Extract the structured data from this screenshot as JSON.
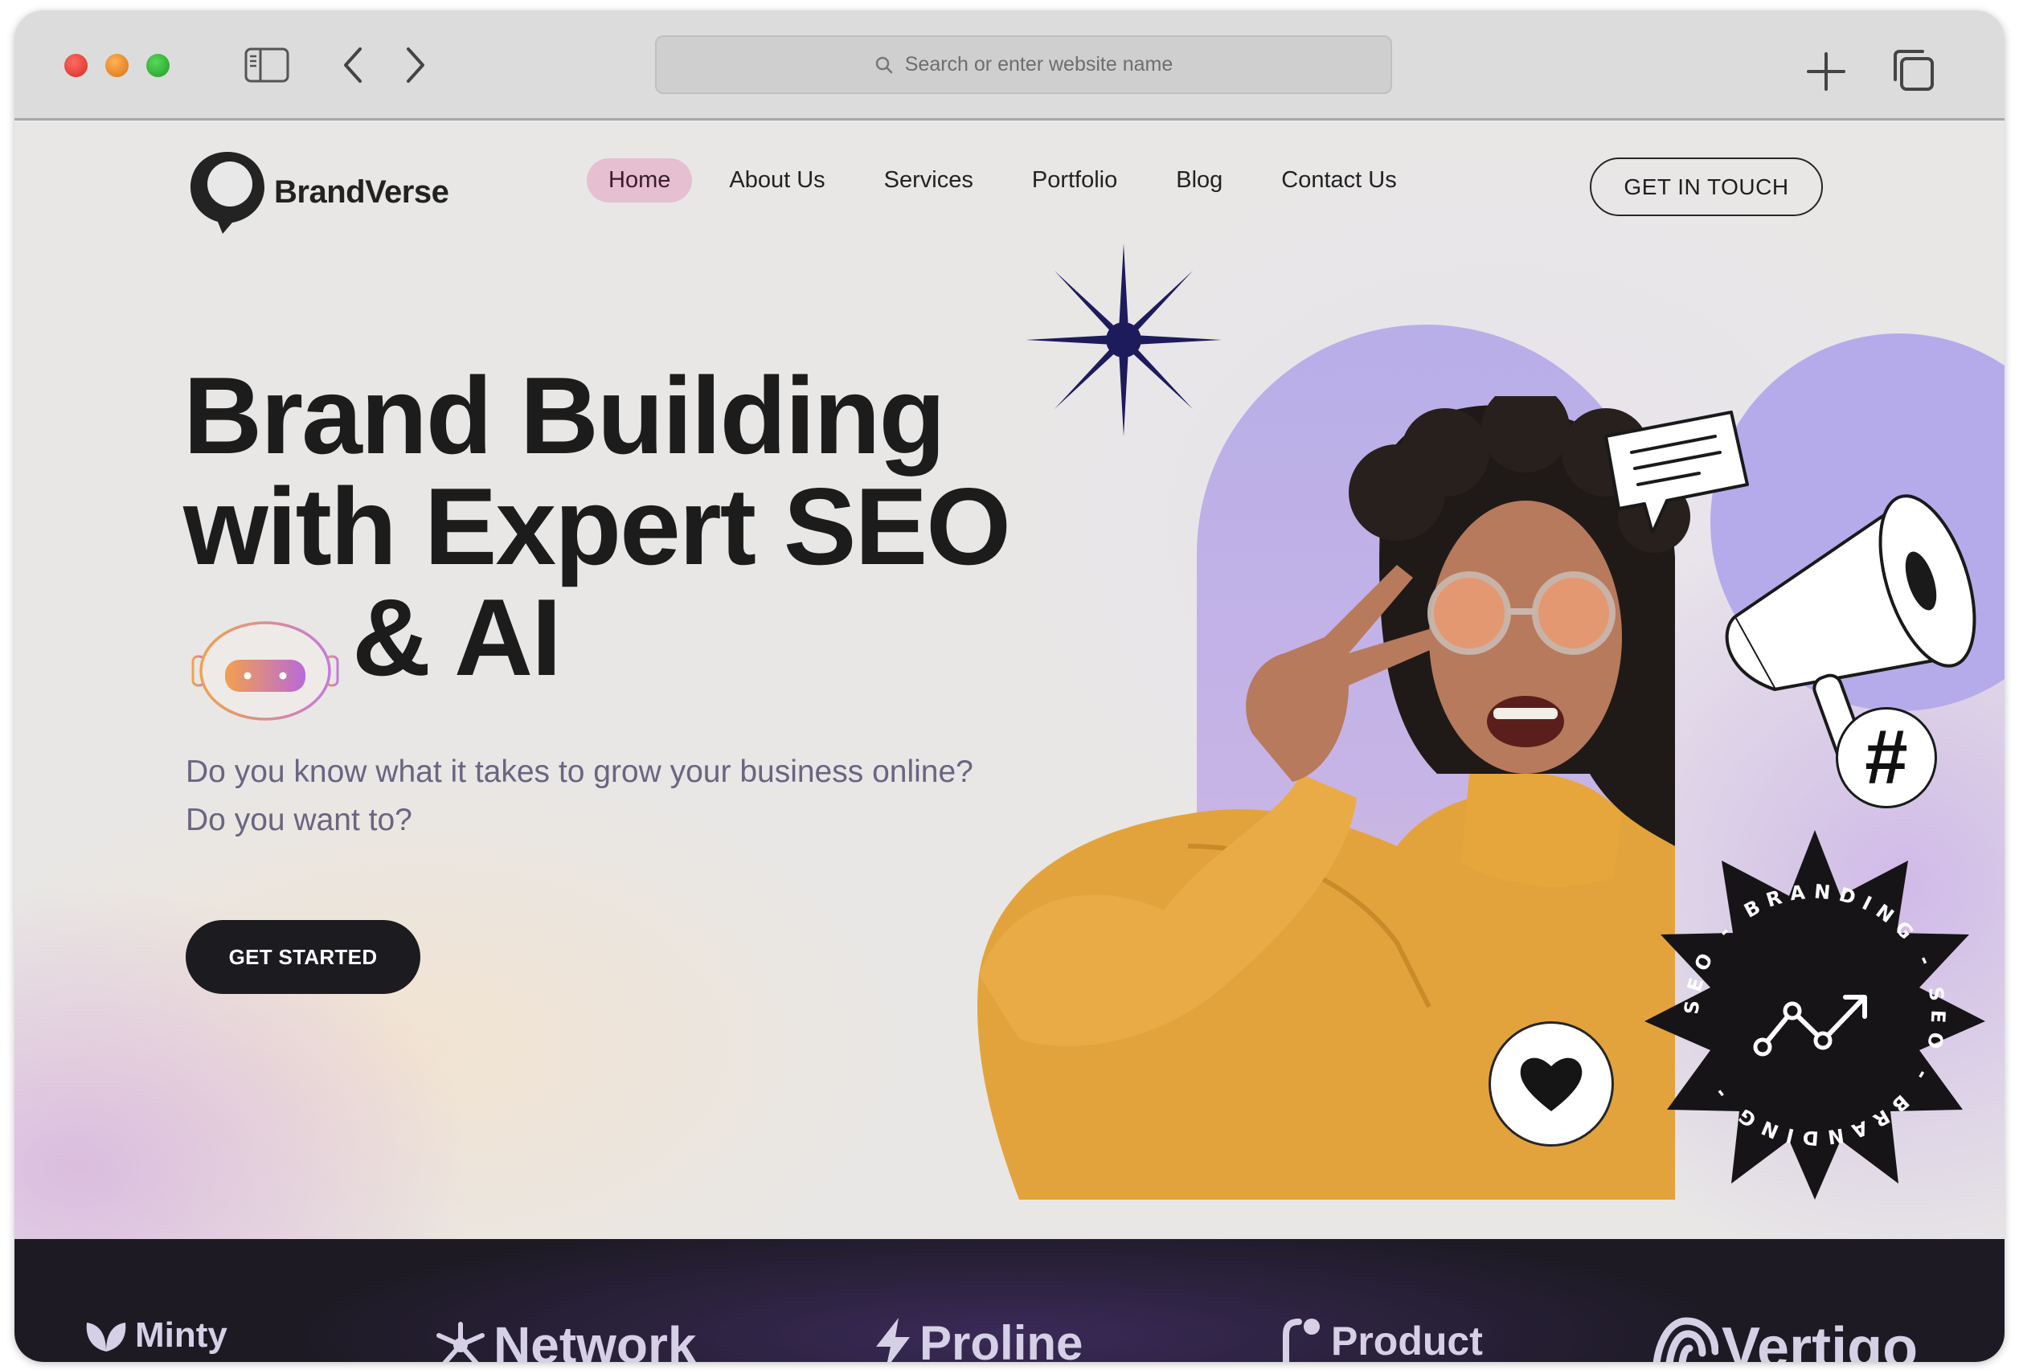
{
  "browser": {
    "url_placeholder": "Search or enter website name"
  },
  "site": {
    "logo_text": "BrandVerse",
    "nav": [
      "Home",
      "About Us",
      "Services",
      "Portfolio",
      "Blog",
      "Contact Us"
    ],
    "active_nav": "Home",
    "cta_touch": "GET IN TOUCH"
  },
  "hero": {
    "title_line1": "Brand Building",
    "title_line2": "with Expert SEO",
    "title_line3": "& AI",
    "subtitle": "Do you know what it takes to grow your business online? Do you want to?",
    "cta": "GET STARTED",
    "seal_text": "SEO - BRANDING - SEO - BRANDING -",
    "hash_symbol": "#"
  },
  "brands": [
    "Minty",
    "Network",
    "Proline",
    "Product",
    "Vertigo"
  ],
  "colors": {
    "active_nav_bg": "#e6bfd1",
    "arch_purple": "#b8aee8",
    "dark_button": "#1c1b1f",
    "star_navy": "#1e1b5c"
  }
}
